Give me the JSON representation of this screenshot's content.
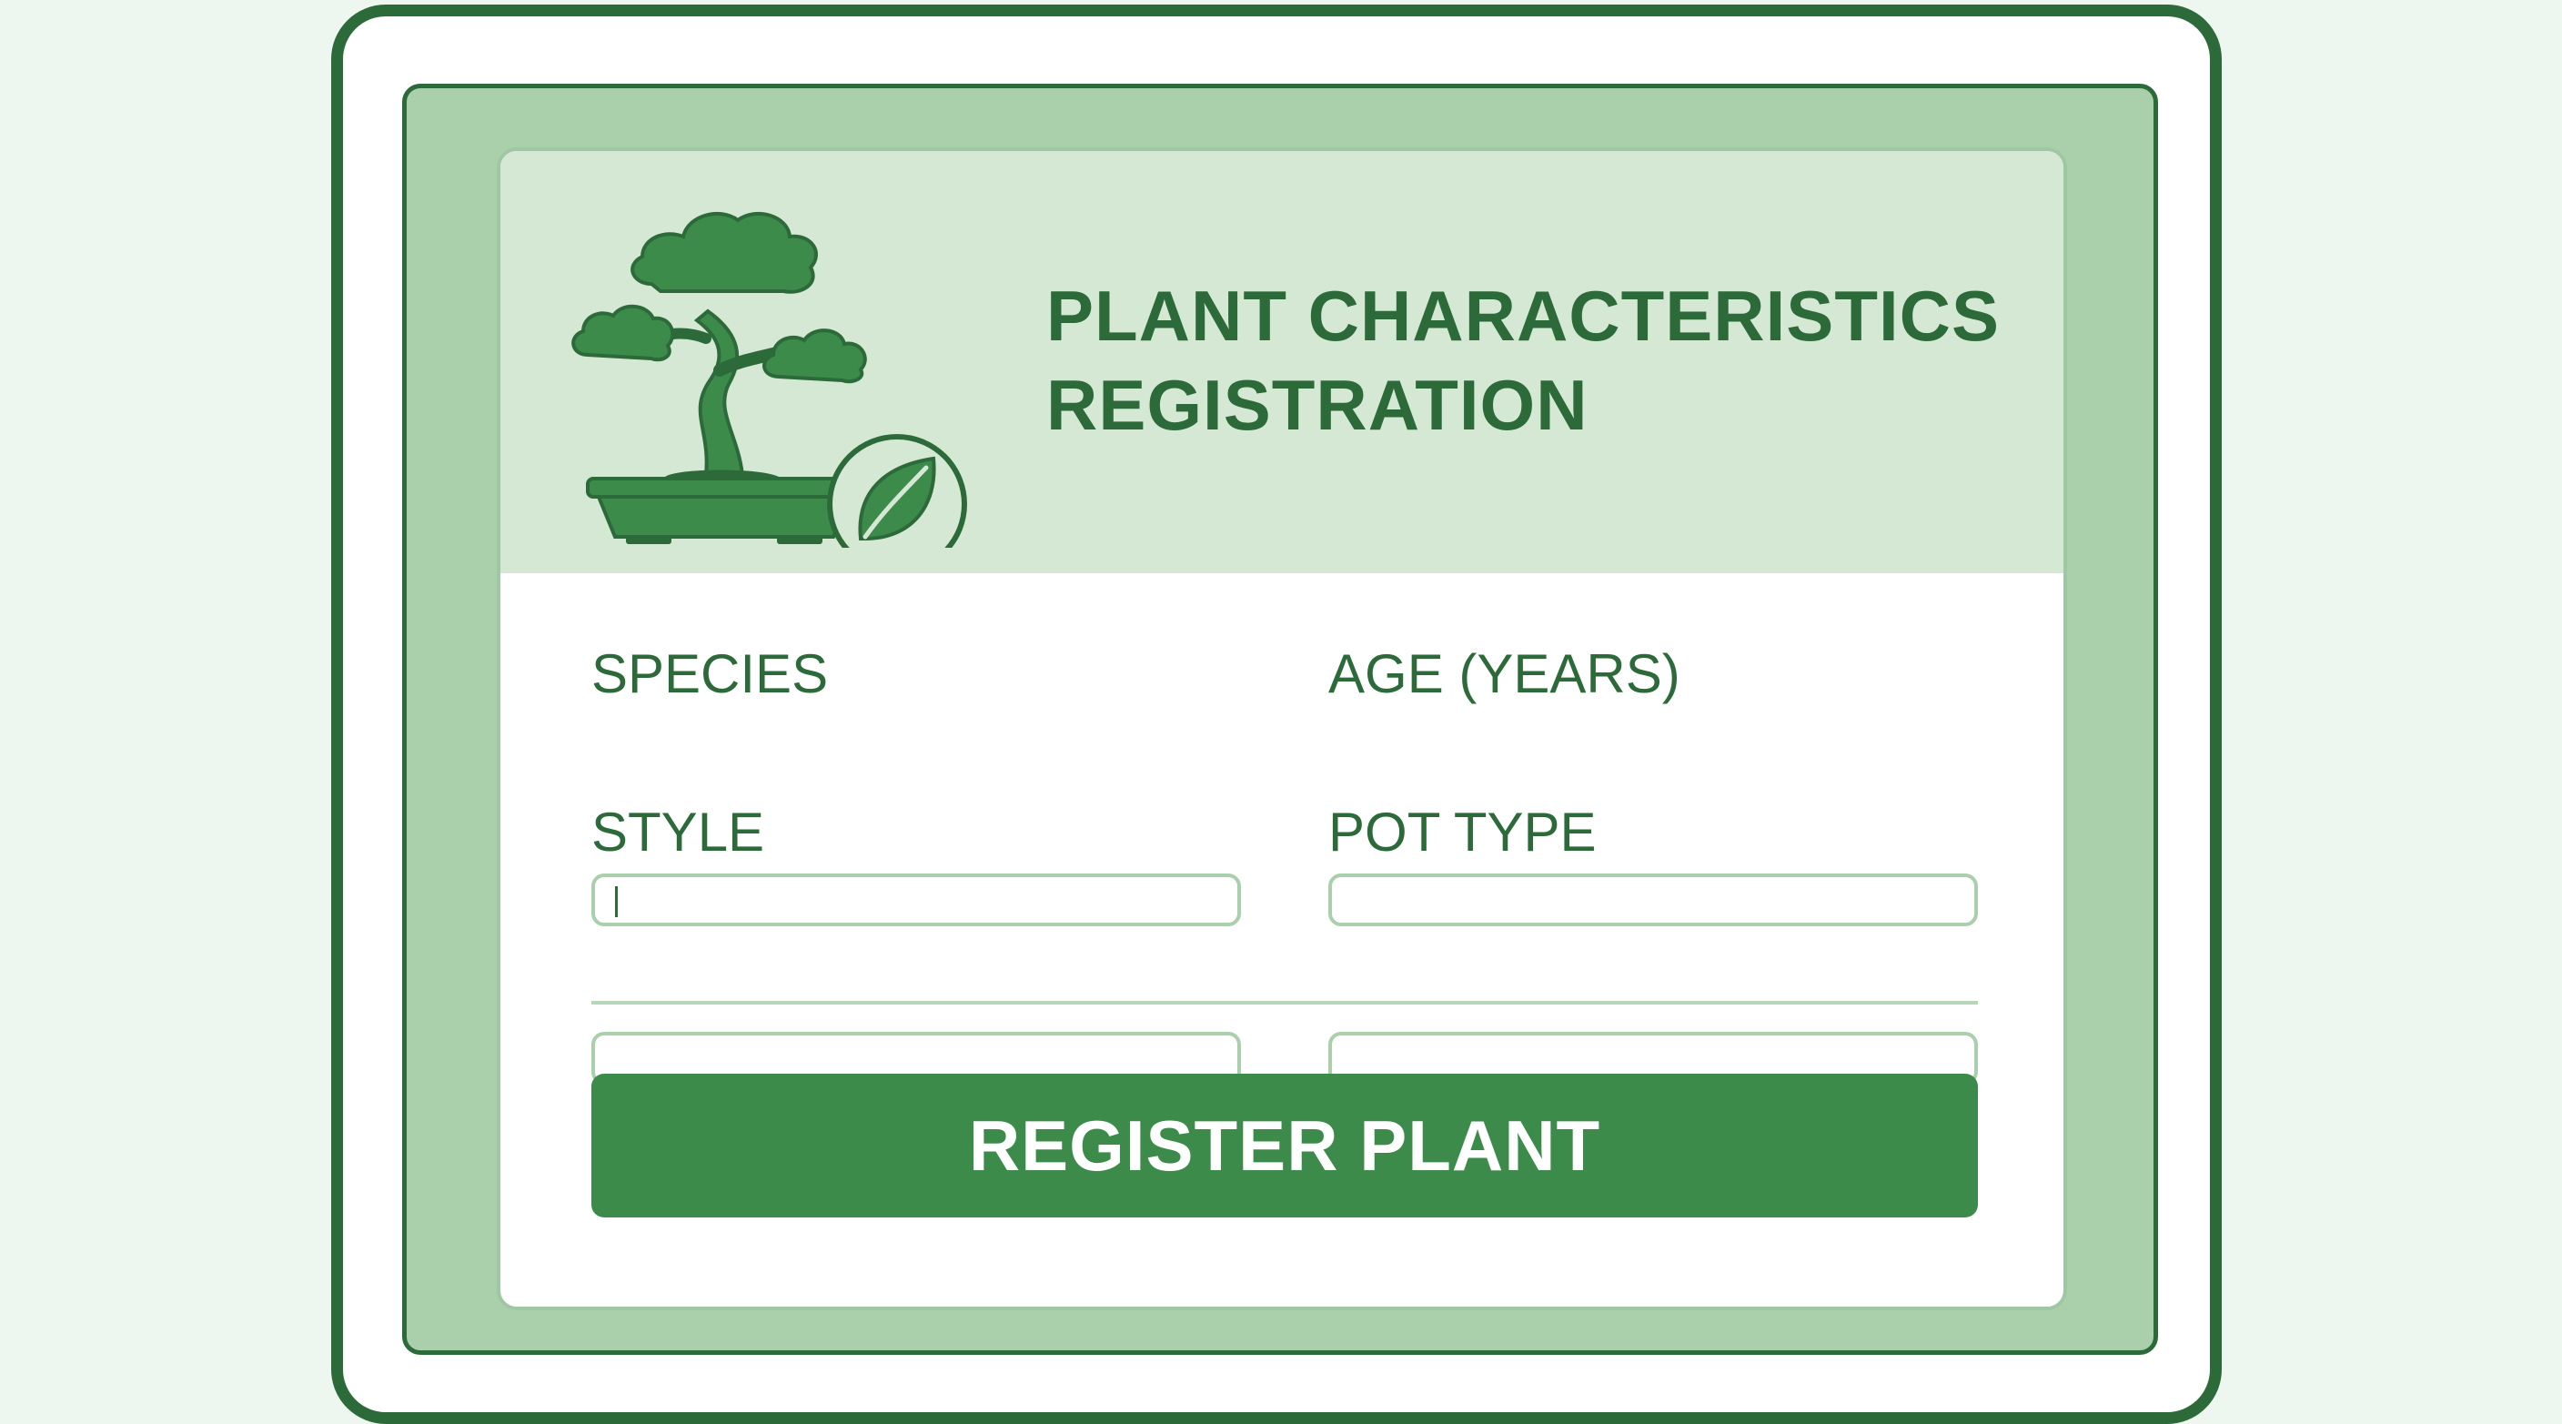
{
  "header": {
    "title_line1": "PLANT CHARACTERISTICS",
    "title_line2": "REGISTRATION",
    "logo_icon": "bonsai-icon",
    "badge_icon": "leaf-icon"
  },
  "form": {
    "species": {
      "label": "SPECIES",
      "value": ""
    },
    "age": {
      "label": "AGE (YEARS)",
      "value": ""
    },
    "style": {
      "label": "STYLE",
      "value": ""
    },
    "pot_type": {
      "label": "POT TYPE",
      "value": ""
    },
    "submit_label": "REGISTER PLANT"
  },
  "colors": {
    "primary": "#3d8b4a",
    "dark_green": "#2d6a3a",
    "header_bg": "#d5e8d4",
    "panel_bg": "#a9cfab",
    "page_bg": "#eef7ef"
  }
}
